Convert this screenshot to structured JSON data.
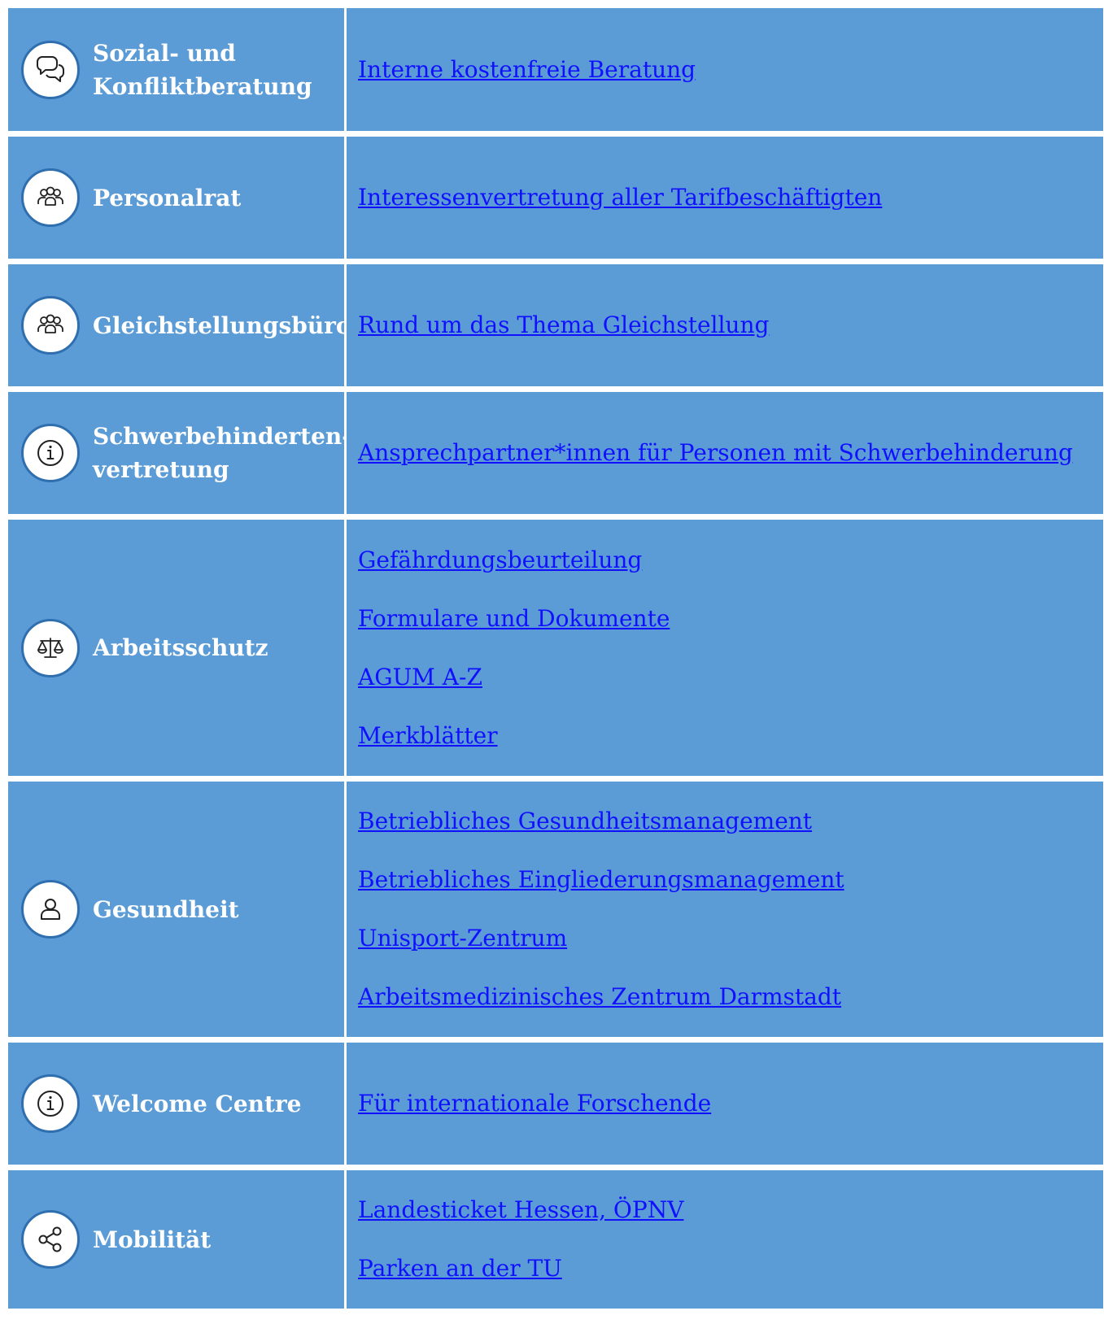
{
  "colors": {
    "cell_bg": "#5c9cd6",
    "icon_border": "#2f6fb0",
    "link": "#1010ff",
    "label": "#ffffff"
  },
  "rows": [
    {
      "icon": "chat-bubbles-icon",
      "label_lines": [
        "Sozial- und",
        "Konfliktberatung"
      ],
      "links": [
        "Interne kostenfreie Beratung"
      ]
    },
    {
      "icon": "group-icon",
      "label_lines": [
        "Personalrat"
      ],
      "links": [
        "Interessenvertretung aller Tarifbeschäftigten"
      ]
    },
    {
      "icon": "group-icon",
      "label_lines": [
        "Gleichstellungsbüro"
      ],
      "links": [
        "Rund um das Thema Gleichstellung"
      ]
    },
    {
      "icon": "info-icon",
      "label_lines": [
        "Schwerbehinderten-",
        "vertretung"
      ],
      "links": [
        "Ansprechpartner*innen für Personen mit Schwerbehinderung"
      ]
    },
    {
      "icon": "scales-icon",
      "label_lines": [
        "Arbeitsschutz"
      ],
      "links": [
        "Gefährdungsbeurteilung",
        "Formulare und Dokumente",
        "AGUM A-Z",
        "Merkblätter"
      ]
    },
    {
      "icon": "person-icon",
      "label_lines": [
        "Gesundheit"
      ],
      "links": [
        "Betriebliches Gesundheitsmanagement",
        "Betriebliches Eingliederungsmanagement",
        "Unisport-Zentrum",
        "Arbeitsmedizinisches Zentrum Darmstadt"
      ]
    },
    {
      "icon": "info-icon",
      "label_lines": [
        "Welcome Centre"
      ],
      "links": [
        "Für internationale Forschende"
      ]
    },
    {
      "icon": "share-icon",
      "label_lines": [
        "Mobilität"
      ],
      "links": [
        "Landesticket Hessen, ÖPNV",
        "Parken an der TU"
      ]
    }
  ]
}
